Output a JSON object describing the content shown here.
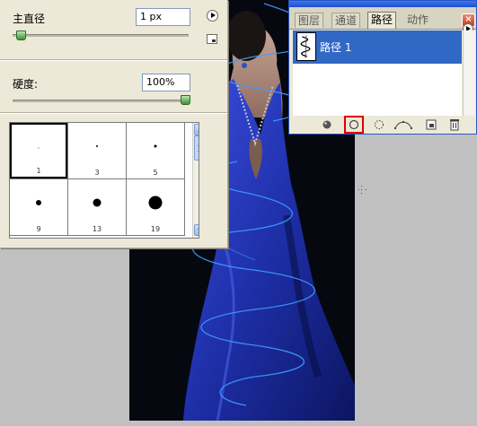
{
  "brush_options": {
    "diameter_label": "主直径",
    "diameter_value": "1 px",
    "hardness_label": "硬度:",
    "hardness_value": "100%",
    "diameter_slider_level": 0.02,
    "hardness_slider_level": 1.0,
    "presets": [
      {
        "size_label": "1",
        "selected": true
      },
      {
        "size_label": "3",
        "selected": false
      },
      {
        "size_label": "5",
        "selected": false
      },
      {
        "size_label": "9",
        "selected": false
      },
      {
        "size_label": "13",
        "selected": false
      },
      {
        "size_label": "19",
        "selected": false
      }
    ]
  },
  "paths_palette": {
    "tabs": [
      "图层",
      "通道",
      "路径",
      "动作"
    ],
    "active_tab": "路径",
    "close_glyph": "×",
    "path_items": [
      {
        "name": "路径 1",
        "selected": true
      }
    ],
    "footer_icons": [
      "fill-path-icon",
      "stroke-path-icon",
      "load-selection-icon",
      "make-work-path-icon",
      "new-path-icon",
      "delete-path-icon"
    ],
    "highlighted_footer_icon": "stroke-path-icon"
  },
  "colors": {
    "panel_bg": "#ece9d8",
    "selection_blue": "#3268c5",
    "highlight_red": "#e00000",
    "dress_blue": "#1e2fa8"
  }
}
